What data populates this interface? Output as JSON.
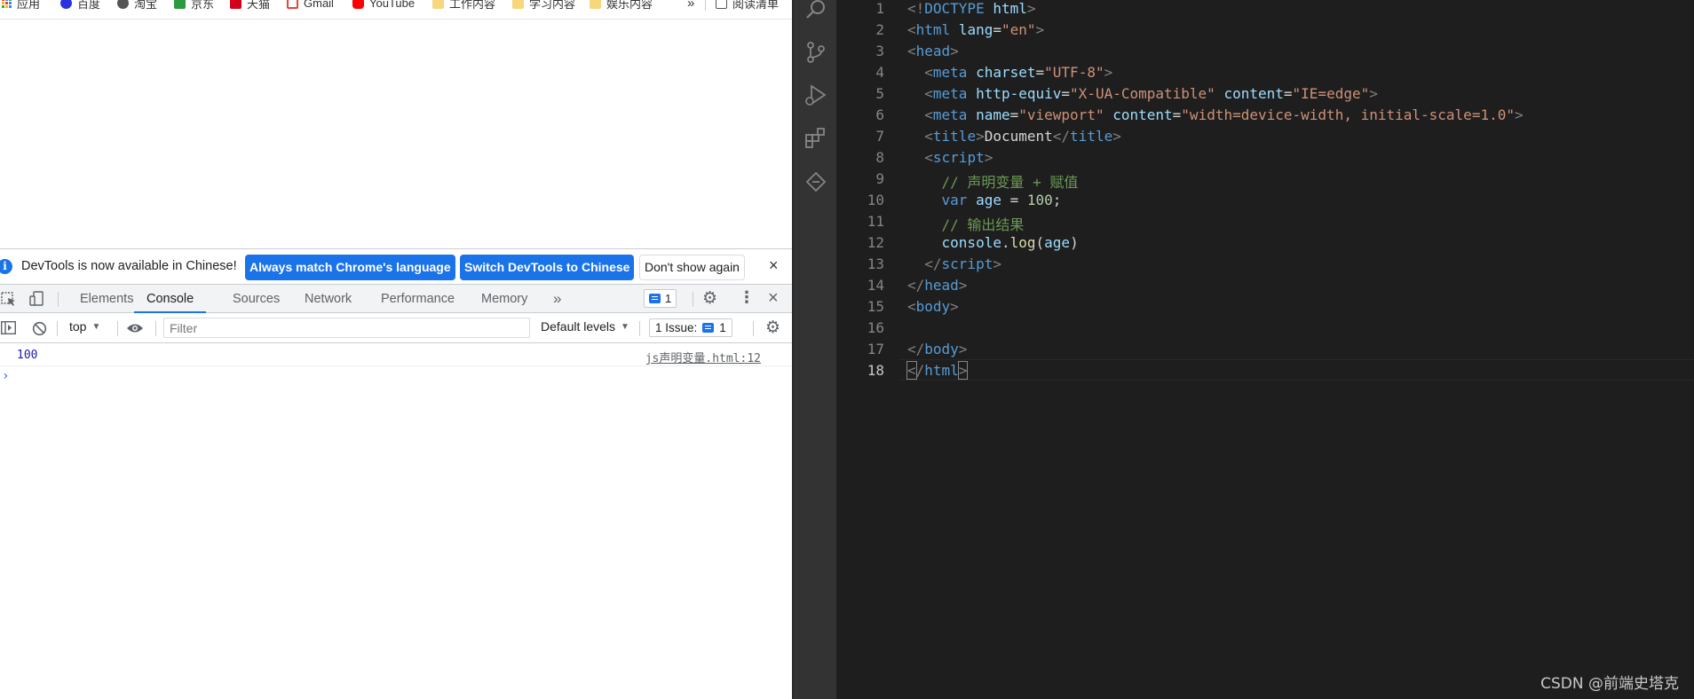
{
  "bookmarks": [
    {
      "label": "应用",
      "icon": "apps-icon"
    },
    {
      "label": "百度",
      "icon": "baidu-icon"
    },
    {
      "label": "淘宝",
      "icon": "taobao-icon"
    },
    {
      "label": "京东",
      "icon": "jd-icon"
    },
    {
      "label": "天猫",
      "icon": "tmall-icon"
    },
    {
      "label": "Gmail",
      "icon": "gmail-icon"
    },
    {
      "label": "YouTube",
      "icon": "youtube-icon"
    },
    {
      "label": "工作内容",
      "icon": "folder-icon"
    },
    {
      "label": "学习内容",
      "icon": "folder-icon"
    },
    {
      "label": "娱乐内容",
      "icon": "folder-icon"
    }
  ],
  "bookmarks_overflow": "»",
  "reading_list": "阅读清单",
  "infobar": {
    "text": "DevTools is now available in Chinese!",
    "match_button": "Always match Chrome's language",
    "switch_button": "Switch DevTools to Chinese",
    "dismiss_button": "Don't show again",
    "close": "×"
  },
  "devtools_tabs": {
    "elements": "Elements",
    "console": "Console",
    "sources": "Sources",
    "network": "Network",
    "performance": "Performance",
    "memory": "Memory",
    "more": "»",
    "messages_count": "1",
    "close": "×"
  },
  "console_toolbar": {
    "context": "top",
    "filter_placeholder": "Filter",
    "levels": "Default levels",
    "issues_label": "1 Issue:",
    "issues_count": "1"
  },
  "console_output": {
    "value": "100",
    "source": "js声明变量.html:12",
    "prompt": "›"
  },
  "editor": {
    "line_numbers": [
      "1",
      "2",
      "3",
      "4",
      "5",
      "6",
      "7",
      "8",
      "9",
      "10",
      "11",
      "12",
      "13",
      "14",
      "15",
      "16",
      "17",
      "18"
    ],
    "current_line": "18",
    "tokens": {
      "doctype_open": "<!",
      "doctype": "DOCTYPE",
      "html": "html",
      "lang_attr": "lang",
      "lang_val": "\"en\"",
      "head": "head",
      "meta": "meta",
      "charset_attr": "charset",
      "charset_val": "\"UTF-8\"",
      "http_equiv_attr": "http-equiv",
      "http_equiv_val": "\"X-UA-Compatible\"",
      "content_attr": "content",
      "content_val_1": "\"IE=edge\"",
      "name_attr": "name",
      "name_val": "\"viewport\"",
      "content_val_2": "\"width=device-width, initial-scale=1.0\"",
      "title": "title",
      "title_text": "Document",
      "script": "script",
      "comment_1": "// 声明变量 + 赋值",
      "var_kw": "var",
      "age": "age",
      "assign": " = ",
      "num": "100",
      "semi": ";",
      "comment_2": "// 输出结果",
      "console": "console",
      "log": "log",
      "body": "body"
    }
  },
  "watermark": "CSDN @前端史塔克"
}
